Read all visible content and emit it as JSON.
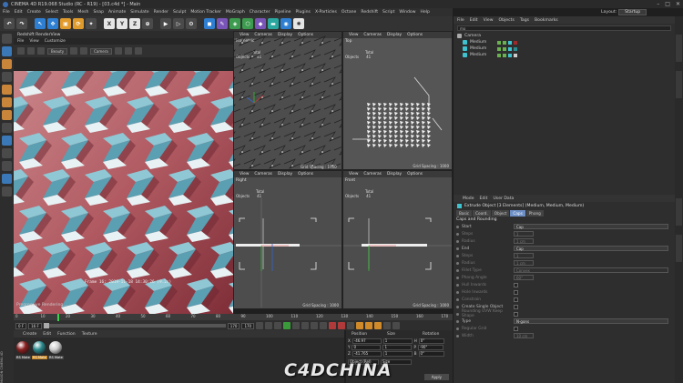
{
  "window": {
    "title": "CINEMA 4D R19.068 Studio (RC - R19) - [03.c4d *] - Main",
    "controls": [
      "–",
      "□",
      "✕"
    ]
  },
  "menubar": {
    "items": [
      "File",
      "Edit",
      "Create",
      "Select",
      "Tools",
      "Mesh",
      "Snap",
      "Animate",
      "Simulate",
      "Render",
      "Sculpt",
      "Motion Tracker",
      "MoGraph",
      "Character",
      "Pipeline",
      "Plugins",
      "X-Particles",
      "Octane",
      "Redshift",
      "Script",
      "Window",
      "Help"
    ],
    "layout_label": "Layout:",
    "layout_value": "Startup"
  },
  "render_view": {
    "title": "Redshift RenderView",
    "menu": [
      "File",
      "View",
      "Customize"
    ],
    "beauty": "Beauty",
    "camera": "Camera",
    "caption": "Frame 16: 2019-11-18 14:30:26 (9.2s)",
    "status": "Progressive Rendering..."
  },
  "viewports": {
    "menu": [
      "View",
      "Cameras",
      "Display",
      "Options"
    ],
    "isometric": {
      "name": "Isometric",
      "total_label": "Total",
      "objects_label": "Objects",
      "objects_value": "41"
    },
    "top": {
      "name": "Top",
      "total_label": "Total",
      "objects_label": "Objects",
      "objects_value": "41",
      "grid": "Grid Spacing : 1000"
    },
    "right": {
      "name": "Right",
      "total_label": "Total",
      "objects_label": "Objects",
      "objects_value": "41",
      "grid": "Grid Spacing : 1000"
    },
    "front": {
      "name": "Front",
      "total_label": "Total",
      "objects_label": "Objects",
      "objects_value": "41",
      "grid": "Grid Spacing : 1000"
    },
    "iso_grid": "Grid Spacing : 1000"
  },
  "timeline": {
    "ticks": [
      "0",
      "10",
      "20",
      "30",
      "40",
      "50",
      "60",
      "70",
      "80",
      "90",
      "100",
      "110",
      "120",
      "130",
      "140",
      "150",
      "160",
      "170"
    ],
    "current_frame": "16 F",
    "start": "0 F",
    "end": "170",
    "end2": "170"
  },
  "material_manager": {
    "menu": [
      "Create",
      "Edit",
      "Function",
      "Texture"
    ],
    "materials": [
      {
        "label": "RS Mate",
        "color": "#8a1f1f"
      },
      {
        "label": "RS Mate",
        "color": "#2d8b8f"
      },
      {
        "label": "RS Mate",
        "color": "#cfcfcf"
      }
    ]
  },
  "coordinates": {
    "headers": [
      "Position",
      "Size",
      "Rotation"
    ],
    "rows": [
      {
        "axis": "X",
        "pos": "-46.97",
        "size": "1",
        "rot_axis": "H",
        "rot": "0°"
      },
      {
        "axis": "Y",
        "pos": "0",
        "size": "1",
        "rot_axis": "P",
        "rot": "-90°"
      },
      {
        "axis": "Z",
        "pos": "-41.765",
        "size": "1",
        "rot_axis": "B",
        "rot": "0°"
      }
    ],
    "mode1": "Object (Rel)",
    "mode2": "Size",
    "apply": "Apply"
  },
  "object_manager": {
    "menu": [
      "File",
      "Edit",
      "View",
      "Objects",
      "Tags",
      "Bookmarks"
    ],
    "search": "mo",
    "objects": [
      {
        "name": "Camera",
        "type": "camera"
      },
      {
        "name": "Medium",
        "type": "extrude"
      },
      {
        "name": "Medium",
        "type": "extrude"
      },
      {
        "name": "Medium",
        "type": "extrude"
      }
    ]
  },
  "attribute_manager": {
    "menu": [
      "Mode",
      "Edit",
      "User Data"
    ],
    "object_title": "Extrude Object [3 Elements] (Medium, Medium, Medium)",
    "tabs": [
      "Basic",
      "Coord.",
      "Object",
      "Caps",
      "Phong"
    ],
    "active_tab": "Caps",
    "section": "Caps and Rounding",
    "attrs": [
      {
        "label": "Start",
        "value": "Cap",
        "kind": "select",
        "dim": false
      },
      {
        "label": "Steps",
        "value": "1",
        "kind": "short",
        "dim": true
      },
      {
        "label": "Radius",
        "value": "1 cm",
        "kind": "short",
        "dim": true
      },
      {
        "label": "End",
        "value": "Cap",
        "kind": "select",
        "dim": false
      },
      {
        "label": "Steps",
        "value": "1",
        "kind": "short",
        "dim": true
      },
      {
        "label": "Radius",
        "value": "1 cm",
        "kind": "short",
        "dim": true
      },
      {
        "label": "Fillet Type",
        "value": "Convex",
        "kind": "select",
        "dim": true
      },
      {
        "label": "Phong Angle",
        "value": "60°",
        "kind": "short",
        "dim": true
      },
      {
        "label": "Hull Inwards",
        "value": "",
        "kind": "check",
        "dim": true
      },
      {
        "label": "Hole Inwards",
        "value": "",
        "kind": "check",
        "dim": true
      },
      {
        "label": "Constrain",
        "value": "",
        "kind": "check",
        "dim": true
      },
      {
        "label": "Create Single Object",
        "value": "",
        "kind": "check",
        "dim": false
      },
      {
        "label": "Rounding UVW Keep Shape",
        "value": "",
        "kind": "check",
        "dim": true
      },
      {
        "label": "Type",
        "value": "N-gons",
        "kind": "select",
        "dim": false
      },
      {
        "label": "Regular Grid",
        "value": "",
        "kind": "check",
        "dim": true
      },
      {
        "label": "Width",
        "value": "10 cm",
        "kind": "short",
        "dim": true
      }
    ]
  },
  "brand": {
    "maxon": "MAXON CINEMA 4D",
    "watermark": "C4DCHINA"
  }
}
